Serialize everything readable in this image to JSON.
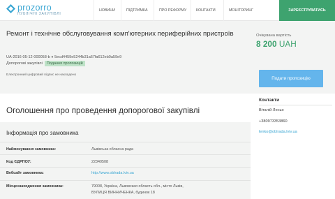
{
  "header": {
    "logo_text": "prozorro",
    "logo_sub": "ПУБЛІЧНІ ЗАКУПІВЛІ",
    "nav": [
      "НОВИНИ",
      "ПІДТРИМКА",
      "ПРО РЕФОРМУ",
      "КОНТАКТИ",
      "МОНІТОРИНГ"
    ],
    "register_label": "ЗАРЕЄСТРУВАТИСЬ"
  },
  "tender": {
    "title": "Ремонт і технічне обслуговування комп'ютерних периферійних пристроїв",
    "id": "UA-2016-05-12-000058-b",
    "bullet": "●",
    "hash": "5ecd4459e5244b31a67fa612eb0a59e9",
    "type": "Допорогові закупівлі",
    "status": "Подання пропозицій",
    "signature": "Електронний цифровий підпис не накладено",
    "value_label": "Очікувана вартість",
    "value_amount": "8 200",
    "value_currency": "UAH",
    "submit_label": "Подати пропозицію"
  },
  "main": {
    "title": "Оголошення про проведення допорогової закупівлі",
    "section_title": "Інформація про замовника",
    "fields": [
      {
        "label": "Найменування замовника:",
        "value": "Львівська обласна рада"
      },
      {
        "label": "Код ЄДРПОУ:",
        "value": "22340508"
      },
      {
        "label": "Вебсайт замовника:",
        "value": "http://www.oblrada.lviv.ua"
      },
      {
        "label": "Місцезнаходження замовника:",
        "value": "79008, Україна, Львовская область обл., місто Львів,",
        "value2": "ВУЛИЦЯ ВИННИЧЕНКА, будинок 18"
      }
    ]
  },
  "contacts": {
    "title": "Контакти",
    "name": "Віталій Леньо",
    "phone": "+380973353860",
    "email": "lenko@oblrada.lviv.ua"
  },
  "colors": {
    "accent_green": "#3ea36f",
    "accent_blue": "#64b5ec",
    "link_blue": "#3aa6d3",
    "panel_gray": "#f3f4f3"
  }
}
